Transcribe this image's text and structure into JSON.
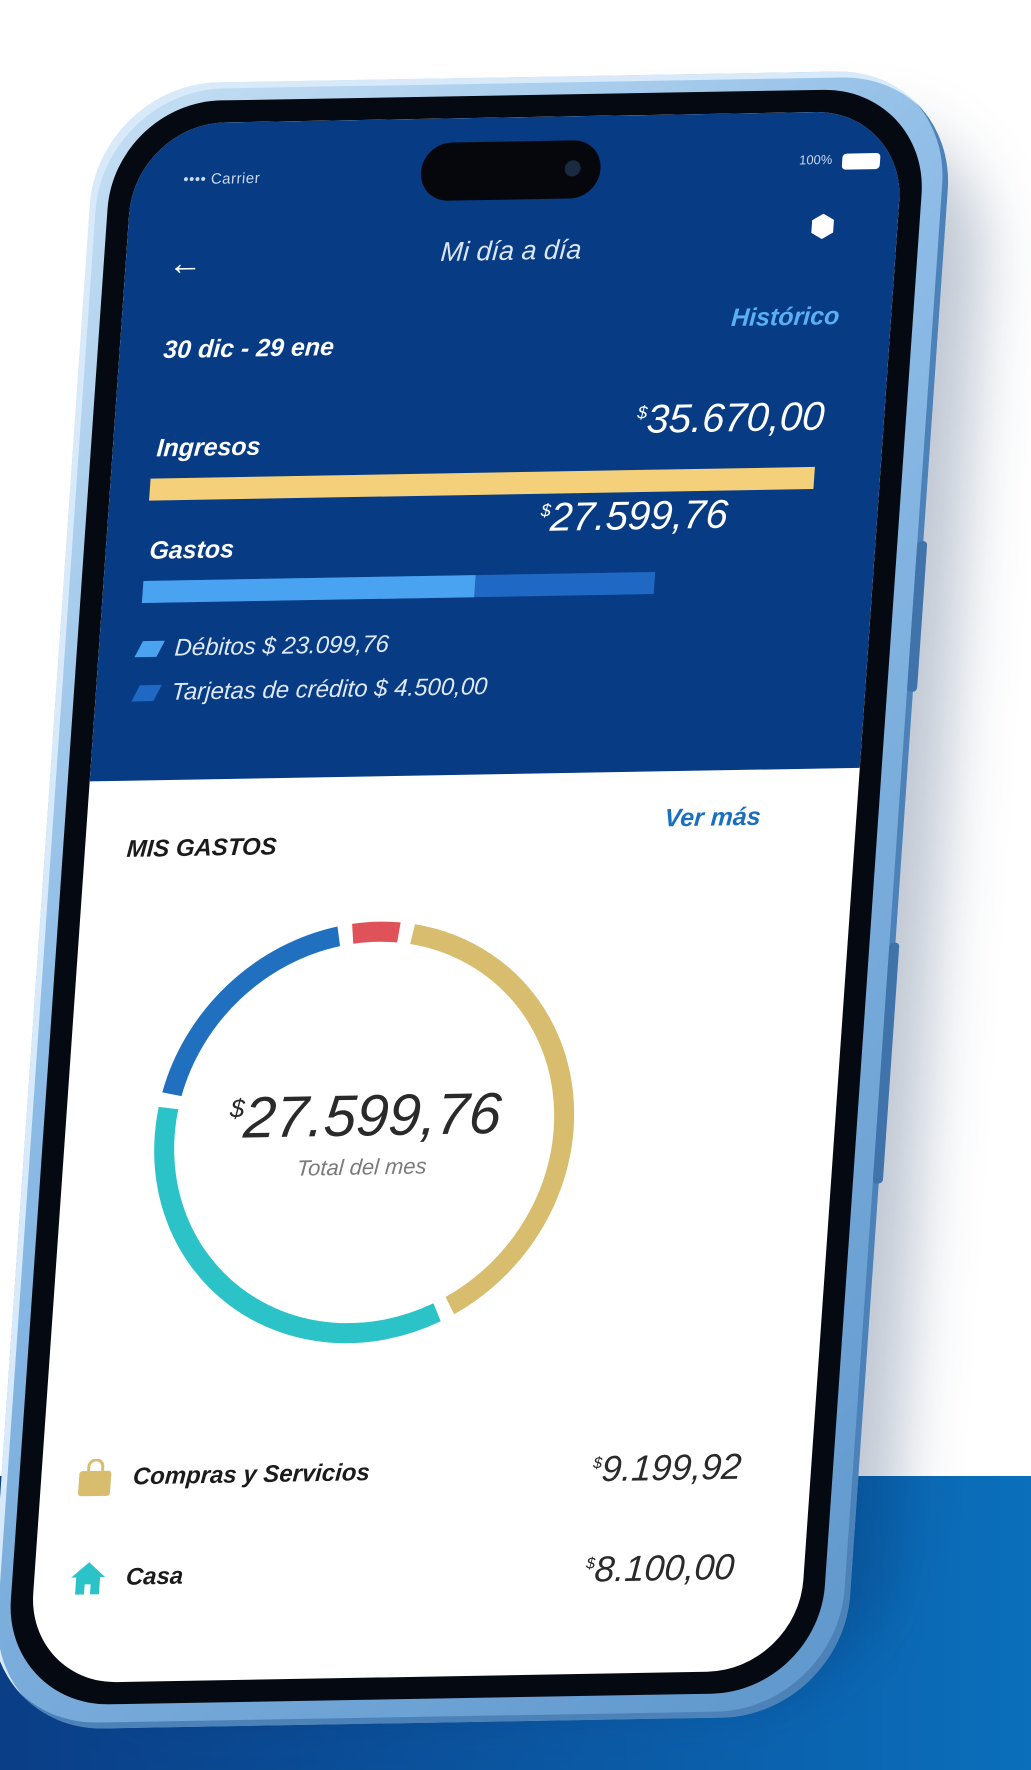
{
  "status": {
    "carrier": "•••• Carrier",
    "battery": "100%"
  },
  "header": {
    "title": "Mi día a día",
    "date_range": "30 dic - 29 ene",
    "history_link": "Histórico"
  },
  "ingresos": {
    "label": "Ingresos",
    "currency": "$",
    "amount": "35.670,00",
    "fill_fraction": 1.0
  },
  "gastos": {
    "label": "Gastos",
    "currency": "$",
    "amount": "27.599,76",
    "fill_fraction": 0.77,
    "debit_fraction_of_bar": 0.65
  },
  "breakdown": [
    {
      "label": "Débitos $ 23.099,76",
      "color": "#4aa3f0"
    },
    {
      "label": "Tarjetas de crédito $ 4.500,00",
      "color": "#1f68c4"
    }
  ],
  "mis_gastos": {
    "title": "MIS GASTOS",
    "more_link": "Ver más",
    "currency": "$",
    "total": "27.599,76",
    "total_label": "Total del mes"
  },
  "chart_data": {
    "type": "pie",
    "title": "",
    "series": [
      {
        "value": 9199.92,
        "color": "#d8bd6e"
      },
      {
        "value": 8100.0,
        "color": "#2cc3c8"
      },
      {
        "value": 4500.0,
        "color": "#2170bf"
      },
      {
        "value": 1100.0,
        "color": "#e0525a"
      }
    ]
  },
  "categories": [
    {
      "label": "Compras y Servicios",
      "currency": "$",
      "amount": "9.199,92",
      "icon": "shopping-bag-icon",
      "color": "#d8bd6e"
    },
    {
      "label": "Casa",
      "currency": "$",
      "amount": "8.100,00",
      "icon": "home-icon",
      "color": "#2cc3c8"
    }
  ]
}
